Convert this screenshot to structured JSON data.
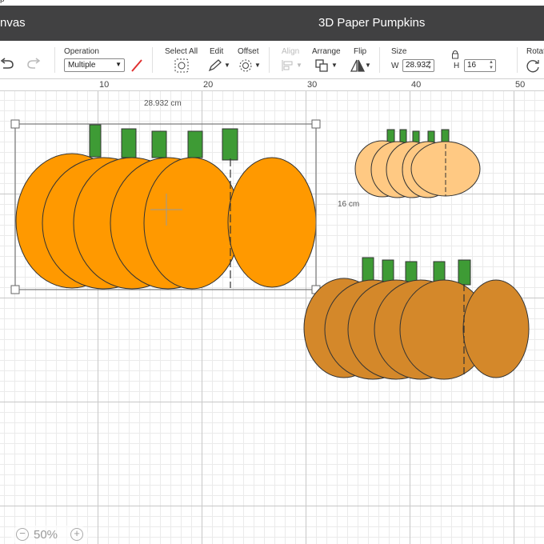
{
  "window": {
    "top_fragment": "p",
    "left_title": "nvas",
    "project_title": "3D Paper Pumpkins"
  },
  "toolbar": {
    "operation_label": "Operation",
    "operation_value": "Multiple",
    "select_all_label": "Select All",
    "edit_label": "Edit",
    "offset_label": "Offset",
    "align_label": "Align",
    "arrange_label": "Arrange",
    "flip_label": "Flip",
    "size_label": "Size",
    "w_label": "W",
    "w_value": "28.932",
    "h_label": "H",
    "h_value": "16",
    "rotate_label": "Rotat"
  },
  "ruler": {
    "ticks": [
      "10",
      "20",
      "30",
      "40",
      "50"
    ]
  },
  "canvas": {
    "width_dimension": "28.932 cm",
    "height_dimension": "16 cm"
  },
  "zoom": {
    "minus": "−",
    "level": "50%",
    "plus": "+"
  },
  "colors": {
    "pumpkin_large": "#ff9900",
    "pumpkin_small": "#ffc983",
    "pumpkin_medium": "#d4882a",
    "stem": "#3e9b35",
    "accent_red": "#e03030",
    "titlebar": "#414142"
  },
  "icons": [
    "undo-icon",
    "redo-icon",
    "select-all-icon",
    "pencil-icon",
    "offset-icon",
    "align-icon",
    "arrange-icon",
    "flip-icon",
    "lock-icon",
    "rotate-icon"
  ]
}
